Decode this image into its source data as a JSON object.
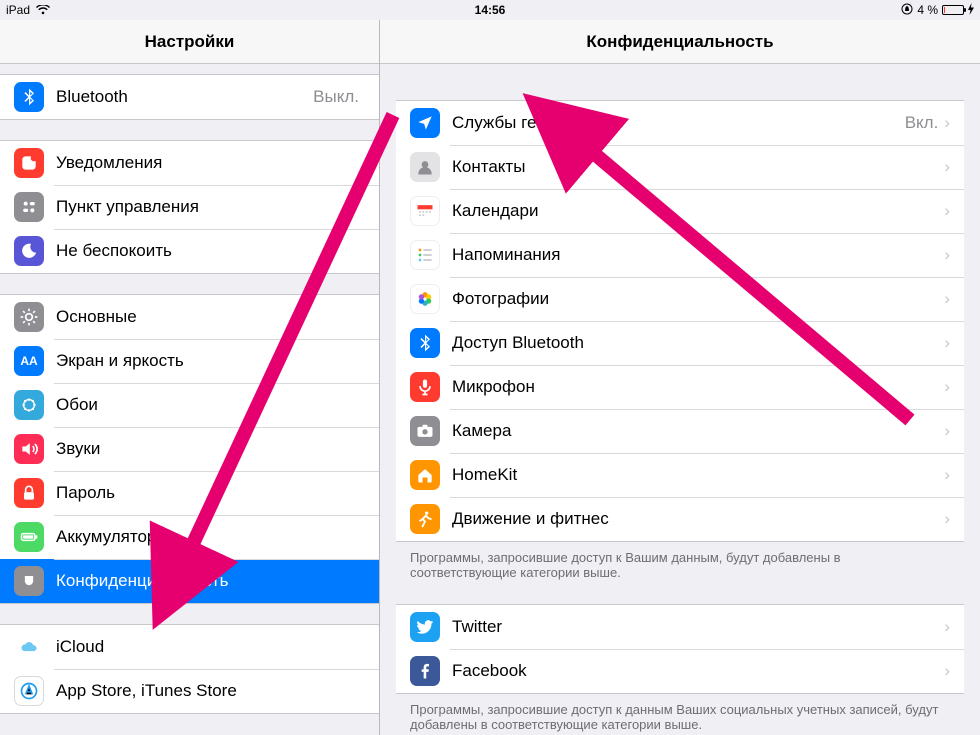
{
  "status_bar": {
    "device": "iPad",
    "time": "14:56",
    "battery_text": "4 %"
  },
  "master": {
    "title": "Настройки",
    "group0": [
      {
        "label": "Bluetooth",
        "value": "Выкл.",
        "icon": "bluetooth"
      }
    ],
    "group1": [
      {
        "label": "Уведомления",
        "icon": "notifications"
      },
      {
        "label": "Пункт управления",
        "icon": "control-center"
      },
      {
        "label": "Не беспокоить",
        "icon": "dnd"
      }
    ],
    "group2": [
      {
        "label": "Основные",
        "icon": "general"
      },
      {
        "label": "Экран и яркость",
        "icon": "display"
      },
      {
        "label": "Обои",
        "icon": "wallpaper"
      },
      {
        "label": "Звуки",
        "icon": "sounds"
      },
      {
        "label": "Пароль",
        "icon": "passcode"
      },
      {
        "label": "Аккумулятор",
        "icon": "battery"
      },
      {
        "label": "Конфиденциальность",
        "icon": "privacy",
        "selected": true
      }
    ],
    "group3": [
      {
        "label": "iCloud",
        "icon": "icloud"
      },
      {
        "label": "App Store, iTunes Store",
        "icon": "appstore"
      }
    ]
  },
  "detail": {
    "title": "Конфиденциальность",
    "group0": [
      {
        "label": "Службы геолокации",
        "value": "Вкл.",
        "icon": "location"
      },
      {
        "label": "Контакты",
        "icon": "contacts"
      },
      {
        "label": "Календари",
        "icon": "calendar"
      },
      {
        "label": "Напоминания",
        "icon": "reminders"
      },
      {
        "label": "Фотографии",
        "icon": "photos"
      },
      {
        "label": "Доступ Bluetooth",
        "icon": "bluetooth"
      },
      {
        "label": "Микрофон",
        "icon": "microphone"
      },
      {
        "label": "Камера",
        "icon": "camera"
      },
      {
        "label": "HomeKit",
        "icon": "homekit"
      },
      {
        "label": "Движение и фитнес",
        "icon": "motion"
      }
    ],
    "footer0": "Программы, запросившие доступ к Вашим данным, будут добавлены в соответствующие категории выше.",
    "group1": [
      {
        "label": "Twitter",
        "icon": "twitter"
      },
      {
        "label": "Facebook",
        "icon": "facebook"
      }
    ],
    "footer1": "Программы, запросившие доступ к данным Ваших социальных учетных записей, будут добавлены в соответствующие категории выше."
  }
}
